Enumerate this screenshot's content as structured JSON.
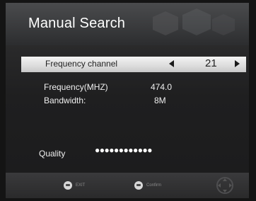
{
  "header": {
    "title": "Manual Search"
  },
  "channel_row": {
    "label": "Frequency channel",
    "value": "21",
    "left_icon": "arrow-left-icon",
    "right_icon": "arrow-right-icon"
  },
  "info": [
    {
      "label": "Frequency(MHZ)",
      "value": "474.0"
    },
    {
      "label": "Bandwidth:",
      "value": "8M"
    }
  ],
  "quality": {
    "label": "Quality",
    "dots": "●●●●●●●●●●●●"
  },
  "footer": {
    "exit_label": "EXIT",
    "confirm_label": "Confirm",
    "exit_icon": "remote-button-icon",
    "confirm_icon": "remote-button-icon",
    "nav_icon": "dpad-icon"
  }
}
